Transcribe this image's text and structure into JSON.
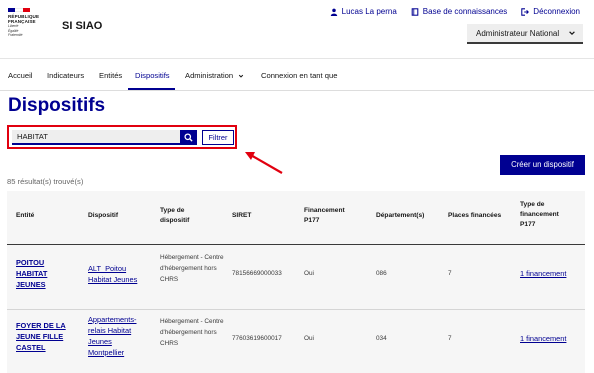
{
  "header": {
    "logo_lines": [
      "RÉPUBLIQUE",
      "FRANÇAISE"
    ],
    "logo_motto": [
      "Liberté",
      "Égalité",
      "Fraternité"
    ],
    "app_name": "SI SIAO",
    "user_link": "Lucas La perna",
    "kb_link": "Base de connaissances",
    "logout_link": "Déconnexion",
    "role_select": "Administrateur National",
    "flag_colors": [
      "#000091",
      "#ffffff",
      "#e1000f"
    ]
  },
  "nav": {
    "items": [
      "Accueil",
      "Indicateurs",
      "Entités",
      "Dispositifs",
      "Administration",
      "Connexion en tant que"
    ],
    "active": "Dispositifs"
  },
  "page": {
    "title": "Dispositifs",
    "search_value": "HABITAT",
    "filter_label": "Filtrer",
    "create_label": "Créer un dispositif",
    "results_text": "85 résultat(s) trouvé(s)"
  },
  "table": {
    "headers": [
      "Entité",
      "Dispositif",
      "Type de dispositif",
      "SIRET",
      "Financement P177",
      "Département(s)",
      "Places financées",
      "Type de financement P177"
    ],
    "rows": [
      {
        "entite": "POITOU HABITAT JEUNES",
        "dispositif": "ALT_Poitou Habitat Jeunes",
        "type": "Hébergement - Centre d'hébergement hors CHRS",
        "siret": "78156669000033",
        "financement": "Oui",
        "departement": "086",
        "places": "7",
        "type_financement": "1 financement"
      },
      {
        "entite": "FOYER DE LA JEUNE FILLE CASTEL",
        "dispositif": "Appartements-relais Habitat Jeunes Montpellier",
        "type": "Hébergement - Centre d'hébergement hors CHRS",
        "siret": "77603619600017",
        "financement": "Oui",
        "departement": "034",
        "places": "7",
        "type_financement": "1 financement"
      }
    ]
  },
  "colors": {
    "primary": "#000091",
    "highlight": "#e1000f"
  }
}
